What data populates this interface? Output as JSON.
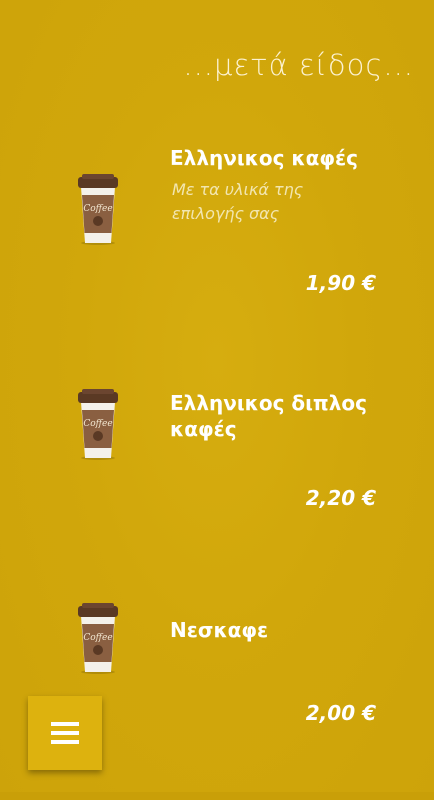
{
  "section_title": "...μετά είδος...",
  "items": [
    {
      "name": "Ελληνικος καφές",
      "description": "Με τα υλικά της επιλογής σας",
      "price": "1,90 €",
      "icon": "coffee-cup-icon"
    },
    {
      "name": "Ελληνικος διπλος καφές",
      "description": "",
      "price": "2,20 €",
      "icon": "coffee-cup-icon"
    },
    {
      "name": "Νεσκαφε",
      "description": "",
      "price": "2,00 €",
      "icon": "coffee-cup-icon"
    }
  ],
  "cup_label": "Coffee",
  "menu_button": {
    "icon": "hamburger-menu-icon"
  },
  "colors": {
    "background": "#d1a70b",
    "accent_button": "#ddb20e"
  }
}
